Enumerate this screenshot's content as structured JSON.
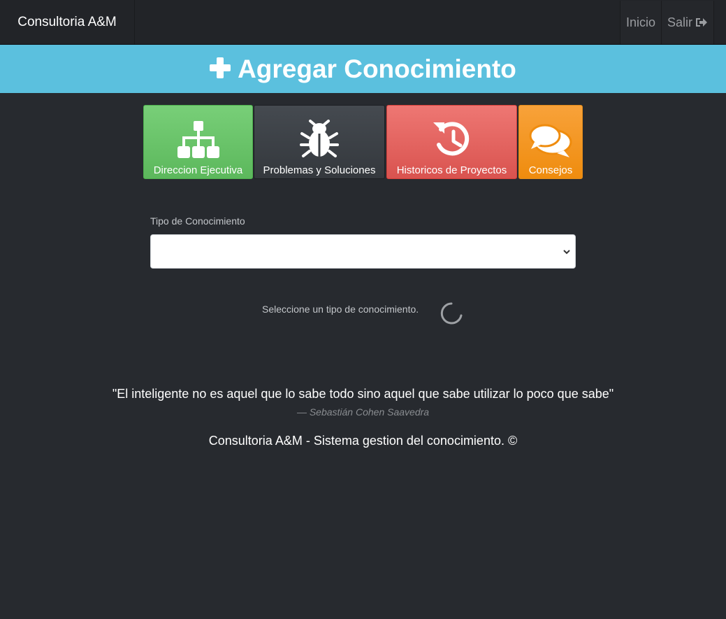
{
  "navbar": {
    "brand": "Consultoria A&M",
    "links": [
      {
        "label": "Inicio"
      },
      {
        "label": "Salir",
        "icon": "sign-out-icon"
      }
    ]
  },
  "banner": {
    "title": "Agregar Conocimiento",
    "icon": "plus-icon",
    "color": "#5bc0de"
  },
  "tiles": [
    {
      "label": "Direccion Ejecutiva",
      "icon": "sitemap-icon",
      "color": "#5cb85c"
    },
    {
      "label": "Problemas y Soluciones",
      "icon": "bug-icon",
      "color": "#3a3e43"
    },
    {
      "label": "Historicos de Proyectos",
      "icon": "history-icon",
      "color": "#d9534f"
    },
    {
      "label": "Consejos",
      "icon": "comments-icon",
      "color": "#ef8c0e"
    }
  ],
  "form": {
    "label": "Tipo de Conocimiento",
    "selected_value": ""
  },
  "hint": "Seleccione un tipo de conocimiento.",
  "quote": {
    "text": "\"El inteligente no es aquel que lo sabe todo sino aquel que sabe utilizar lo poco que sabe\"",
    "author": "— Sebastián Cohen Saavedra"
  },
  "footer": "Consultoria A&M - Sistema gestion del conocimiento. ©"
}
